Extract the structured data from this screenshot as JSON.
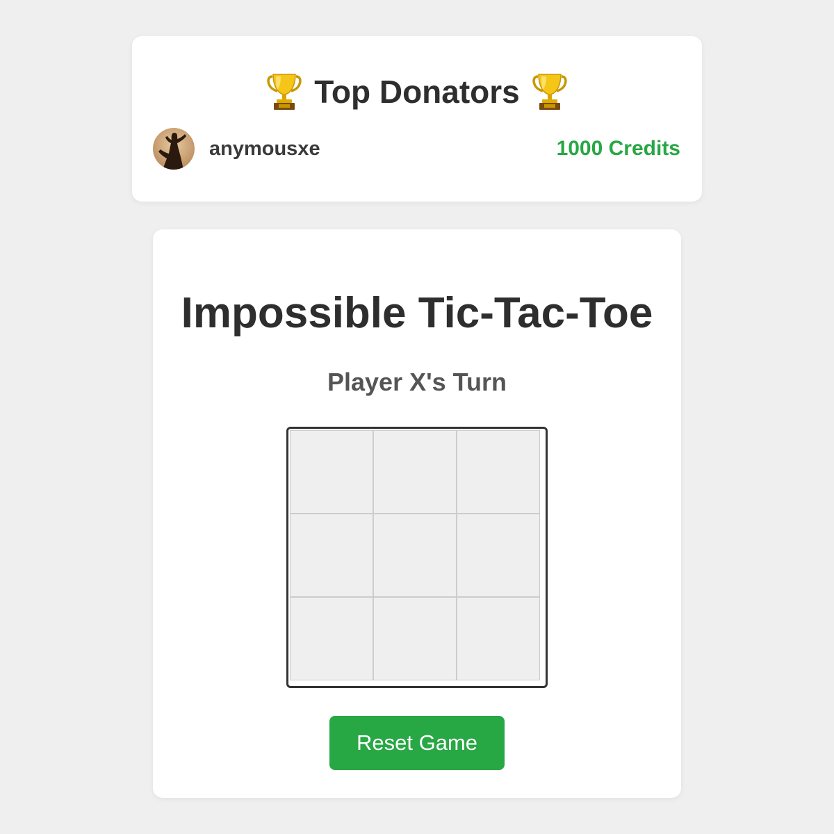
{
  "donators": {
    "title": "Top Donators",
    "icon_left": "trophy-icon",
    "icon_right": "trophy-icon",
    "entries": [
      {
        "name": "anymousxe",
        "credits": "1000 Credits",
        "avatar": "user-avatar"
      }
    ]
  },
  "game": {
    "title": "Impossible Tic-Tac-Toe",
    "status": "Player X's Turn",
    "board": [
      "",
      "",
      "",
      "",
      "",
      "",
      "",
      "",
      ""
    ],
    "reset_label": "Reset Game"
  },
  "colors": {
    "background": "#efefef",
    "card": "#ffffff",
    "accent_green": "#28a745",
    "text_dark": "#2e2e2e",
    "board_border": "#333333",
    "cell_fill": "#efefef",
    "cell_line": "#cccccc"
  }
}
